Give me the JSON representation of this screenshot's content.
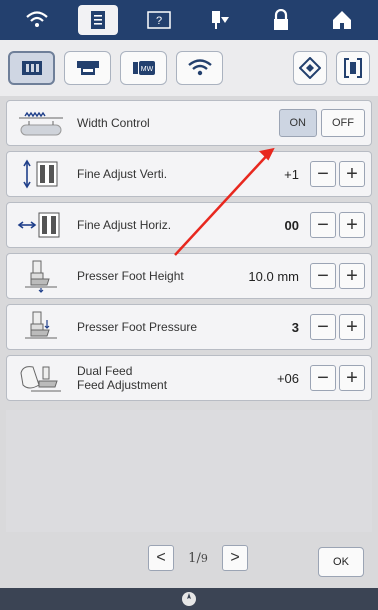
{
  "topbar": {
    "icons": [
      "wifi-icon",
      "document-icon",
      "help-icon",
      "needle-icon",
      "lock-icon",
      "home-icon"
    ]
  },
  "toolbar": {
    "icons": [
      "settings-book-icon",
      "machine-icon",
      "embroidery-frame-icon",
      "wifi-icon",
      "diamond-icon",
      "bracket-icon"
    ]
  },
  "rows": [
    {
      "label": "Width Control",
      "on_label": "ON",
      "off_label": "OFF",
      "selected": "ON"
    },
    {
      "label": "Fine Adjust Verti.",
      "value": "+1"
    },
    {
      "label": "Fine Adjust Horiz.",
      "value": "00"
    },
    {
      "label": "Presser Foot Height",
      "value": "10.0 mm"
    },
    {
      "label": "Presser Foot Pressure",
      "value": "3"
    },
    {
      "label_line1": "Dual Feed",
      "label_line2": "Feed Adjustment",
      "value": "+06"
    }
  ],
  "stepper": {
    "minus": "−",
    "plus": "+"
  },
  "pager": {
    "prev": "<",
    "next": ">",
    "current": "1",
    "total": "9"
  },
  "ok_label": "OK",
  "colors": {
    "topbar": "#23406e",
    "annotation_arrow": "#e8281f",
    "selected": "#cdd5e2"
  }
}
